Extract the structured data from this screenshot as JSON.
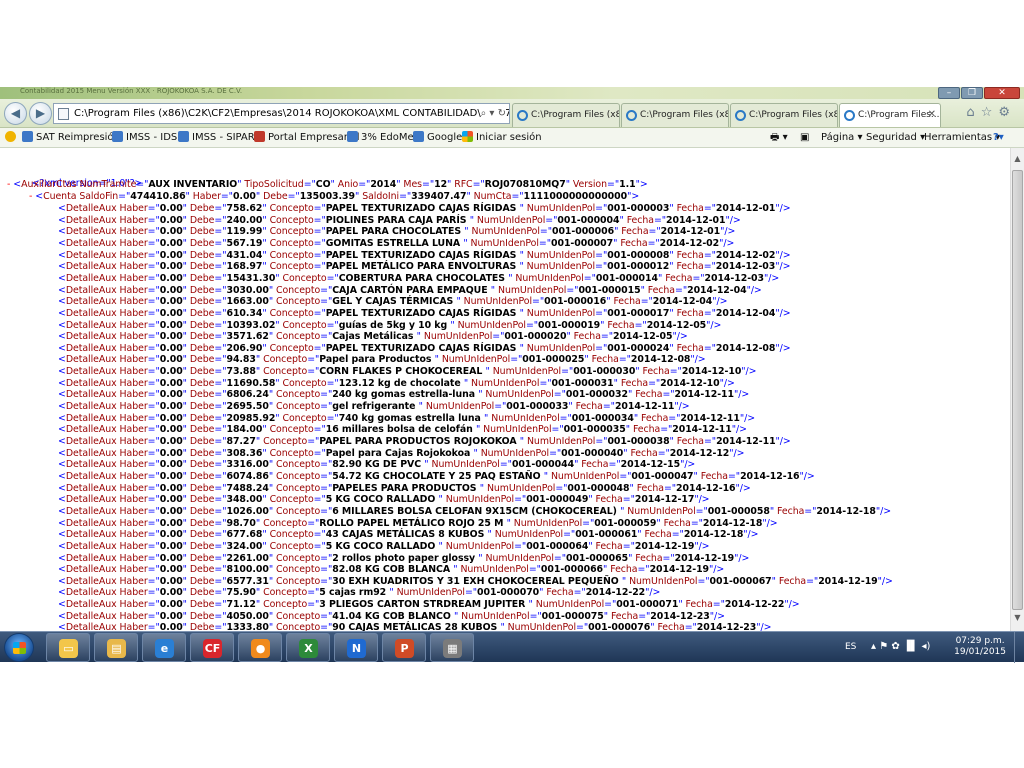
{
  "window": {
    "title_faded": "Contabilidad 2015 Menu Versión XXX · ROJOKOKOA S.A. DE C.V.",
    "buttons": [
      "–",
      "❐",
      "✕"
    ]
  },
  "toolbar": {
    "back_icon": "back-arrow-icon",
    "forward_icon": "forward-arrow-icon",
    "address": "C:\\Program Files (x86)\\C2K\\CF2\\Empresas\\2014 ROJOKOKOA\\XML CONTABILIDAD\\ROJ070810MQ7",
    "address_tools": "⌕ ▾ ↻"
  },
  "tabs": [
    {
      "label": "C:\\Program Files (x8..."
    },
    {
      "label": "C:\\Program Files (x8..."
    },
    {
      "label": "C:\\Program Files (x8..."
    },
    {
      "label": "C:\\Program Files...",
      "active": true
    }
  ],
  "favorites": [
    {
      "label": "SAT Reimpresión",
      "color": "#3d78c7"
    },
    {
      "label": "IMSS - IDSE",
      "color": "#3d78c7"
    },
    {
      "label": "IMSS - SIPARE",
      "color": "#3d78c7"
    },
    {
      "label": "Portal Empresarial",
      "color": "#c0392b"
    },
    {
      "label": "3% EdoMex",
      "color": "#3d78c7"
    },
    {
      "label": "Google",
      "color": "#3d78c7"
    },
    {
      "label": "Iniciar sesión",
      "color": "#e67e22"
    }
  ],
  "commands": {
    "page": "Página ▾",
    "safety": "Seguridad ▾",
    "tools": "Herramientas ▾",
    "help": "?▾"
  },
  "xml": {
    "declaration": "<?xml version=\"1.0\"?>",
    "root": {
      "NumTramite": "AUX INVENTARIO",
      "TipoSolicitud": "CO",
      "Anio": "2014",
      "Mes": "12",
      "RFC": "ROJ070810MQ7",
      "Version": "1.1"
    },
    "cuenta": {
      "SaldoFin": "474410.86",
      "Haber": "0.00",
      "Debe": "135003.39",
      "SaldoIni": "339407.47",
      "NumCta": "1111000000000000"
    },
    "rows": [
      {
        "Haber": "0.00",
        "Debe": "758.62",
        "Concepto": "PAPEL TEXTURIZADO CAJAS RÍGIDAS ",
        "NumUnIdenPol": "001-000003",
        "Fecha": "2014-12-01"
      },
      {
        "Haber": "0.00",
        "Debe": "240.00",
        "Concepto": "PIOLINES PARA CAJA PARÍS ",
        "NumUnIdenPol": "001-000004",
        "Fecha": "2014-12-01"
      },
      {
        "Haber": "0.00",
        "Debe": "119.99",
        "Concepto": "PAPEL PARA CHOCOLATES ",
        "NumUnIdenPol": "001-000006",
        "Fecha": "2014-12-01"
      },
      {
        "Haber": "0.00",
        "Debe": "567.19",
        "Concepto": "GOMITAS ESTRELLA LUNA ",
        "NumUnIdenPol": "001-000007",
        "Fecha": "2014-12-02"
      },
      {
        "Haber": "0.00",
        "Debe": "431.04",
        "Concepto": "PAPEL TEXTURIZADO CAJAS RÍGIDAS ",
        "NumUnIdenPol": "001-000008",
        "Fecha": "2014-12-02"
      },
      {
        "Haber": "0.00",
        "Debe": "168.97",
        "Concepto": "PAPEL METÁLICO PARA ENVOLTURAS ",
        "NumUnIdenPol": "001-000012",
        "Fecha": "2014-12-03"
      },
      {
        "Haber": "0.00",
        "Debe": "15431.30",
        "Concepto": "COBERTURA PARA CHOCOLATES ",
        "NumUnIdenPol": "001-000014",
        "Fecha": "2014-12-03"
      },
      {
        "Haber": "0.00",
        "Debe": "3030.00",
        "Concepto": "CAJA CARTÓN PARA EMPAQUE ",
        "NumUnIdenPol": "001-000015",
        "Fecha": "2014-12-04"
      },
      {
        "Haber": "0.00",
        "Debe": "1663.00",
        "Concepto": "GEL Y CAJAS TÉRMICAS ",
        "NumUnIdenPol": "001-000016",
        "Fecha": "2014-12-04"
      },
      {
        "Haber": "0.00",
        "Debe": "610.34",
        "Concepto": "PAPEL TEXTURIZADO CAJAS RÍGIDAS ",
        "NumUnIdenPol": "001-000017",
        "Fecha": "2014-12-04"
      },
      {
        "Haber": "0.00",
        "Debe": "10393.02",
        "Concepto": "guías de 5kg y 10 kg ",
        "NumUnIdenPol": "001-000019",
        "Fecha": "2014-12-05"
      },
      {
        "Haber": "0.00",
        "Debe": "3571.62",
        "Concepto": "Cajas Metálicas ",
        "NumUnIdenPol": "001-000020",
        "Fecha": "2014-12-05"
      },
      {
        "Haber": "0.00",
        "Debe": "206.90",
        "Concepto": "PAPEL TEXTURIZADO CAJAS RÍGIDAS ",
        "NumUnIdenPol": "001-000024",
        "Fecha": "2014-12-08"
      },
      {
        "Haber": "0.00",
        "Debe": "94.83",
        "Concepto": "Papel para Productos ",
        "NumUnIdenPol": "001-000025",
        "Fecha": "2014-12-08"
      },
      {
        "Haber": "0.00",
        "Debe": "73.88",
        "Concepto": "CORN FLAKES P CHOKOCEREAL ",
        "NumUnIdenPol": "001-000030",
        "Fecha": "2014-12-10"
      },
      {
        "Haber": "0.00",
        "Debe": "11690.58",
        "Concepto": "123.12 kg de chocolate ",
        "NumUnIdenPol": "001-000031",
        "Fecha": "2014-12-10"
      },
      {
        "Haber": "0.00",
        "Debe": "6806.24",
        "Concepto": "240 kg gomas estrella-luna ",
        "NumUnIdenPol": "001-000032",
        "Fecha": "2014-12-11"
      },
      {
        "Haber": "0.00",
        "Debe": "2695.50",
        "Concepto": "gel refrigerante ",
        "NumUnIdenPol": "001-000033",
        "Fecha": "2014-12-11"
      },
      {
        "Haber": "0.00",
        "Debe": "20985.92",
        "Concepto": "740 kg gomas estrella luna ",
        "NumUnIdenPol": "001-000034",
        "Fecha": "2014-12-11"
      },
      {
        "Haber": "0.00",
        "Debe": "184.00",
        "Concepto": "16 millares bolsa de celofán ",
        "NumUnIdenPol": "001-000035",
        "Fecha": "2014-12-11"
      },
      {
        "Haber": "0.00",
        "Debe": "87.27",
        "Concepto": "PAPEL PARA PRODUCTOS ROJOKOKOA ",
        "NumUnIdenPol": "001-000038",
        "Fecha": "2014-12-11"
      },
      {
        "Haber": "0.00",
        "Debe": "308.36",
        "Concepto": "Papel para Cajas Rojokokoa ",
        "NumUnIdenPol": "001-000040",
        "Fecha": "2014-12-12"
      },
      {
        "Haber": "0.00",
        "Debe": "3316.00",
        "Concepto": "82.90 KG DE PVC ",
        "NumUnIdenPol": "001-000044",
        "Fecha": "2014-12-15"
      },
      {
        "Haber": "0.00",
        "Debe": "6074.86",
        "Concepto": "54.72 KG CHOCOLATE Y 25 PAQ ESTAÑO ",
        "NumUnIdenPol": "001-000047",
        "Fecha": "2014-12-16"
      },
      {
        "Haber": "0.00",
        "Debe": "7488.24",
        "Concepto": "PAPELES PARA PRODUCTOS ",
        "NumUnIdenPol": "001-000048",
        "Fecha": "2014-12-16"
      },
      {
        "Haber": "0.00",
        "Debe": "348.00",
        "Concepto": "5 KG COCO RALLADO ",
        "NumUnIdenPol": "001-000049",
        "Fecha": "2014-12-17"
      },
      {
        "Haber": "0.00",
        "Debe": "1026.00",
        "Concepto": "6 MILLARES BOLSA CELOFAN 9X15CM (CHOKOCEREAL) ",
        "NumUnIdenPol": "001-000058",
        "Fecha": "2014-12-18"
      },
      {
        "Haber": "0.00",
        "Debe": "98.70",
        "Concepto": "ROLLO PAPEL METÁLICO ROJO 25 M ",
        "NumUnIdenPol": "001-000059",
        "Fecha": "2014-12-18"
      },
      {
        "Haber": "0.00",
        "Debe": "677.68",
        "Concepto": "43 CAJAS METÁLICAS 8 KUBOS ",
        "NumUnIdenPol": "001-000061",
        "Fecha": "2014-12-18"
      },
      {
        "Haber": "0.00",
        "Debe": "324.00",
        "Concepto": "5 KG COCO RALLADO ",
        "NumUnIdenPol": "001-000064",
        "Fecha": "2014-12-19"
      },
      {
        "Haber": "0.00",
        "Debe": "2261.00",
        "Concepto": "2 rollos photo paper glossy ",
        "NumUnIdenPol": "001-000065",
        "Fecha": "2014-12-19"
      },
      {
        "Haber": "0.00",
        "Debe": "8100.00",
        "Concepto": "82.08 KG COB BLANCA ",
        "NumUnIdenPol": "001-000066",
        "Fecha": "2014-12-19"
      },
      {
        "Haber": "0.00",
        "Debe": "6577.31",
        "Concepto": "30 EXH KUADRITOS Y 31 EXH CHOKOCEREAL PEQUEÑO ",
        "NumUnIdenPol": "001-000067",
        "Fecha": "2014-12-19"
      },
      {
        "Haber": "0.00",
        "Debe": "75.90",
        "Concepto": "5 cajas rm92 ",
        "NumUnIdenPol": "001-000070",
        "Fecha": "2014-12-22"
      },
      {
        "Haber": "0.00",
        "Debe": "71.12",
        "Concepto": "3 PLIEGOS CARTON STRDREAM JUPITER ",
        "NumUnIdenPol": "001-000071",
        "Fecha": "2014-12-22"
      },
      {
        "Haber": "0.00",
        "Debe": "4050.00",
        "Concepto": "41.04 KG COB BLANCO ",
        "NumUnIdenPol": "001-000075",
        "Fecha": "2014-12-23"
      },
      {
        "Haber": "0.00",
        "Debe": "1333.80",
        "Concepto": "90 CAJAS METÁLICAS 28 KUBOS ",
        "NumUnIdenPol": "001-000076",
        "Fecha": "2014-12-23"
      }
    ]
  },
  "taskbar": {
    "apps": [
      {
        "name": "show-windows",
        "glyph": "▭",
        "color": "#f3c64a"
      },
      {
        "name": "file-explorer",
        "glyph": "▤",
        "color": "#e8b84a"
      },
      {
        "name": "internet-explorer",
        "glyph": "e",
        "color": "#2a7fd4"
      },
      {
        "name": "cf-app",
        "glyph": "CF",
        "color": "#d9262c"
      },
      {
        "name": "orange-app",
        "glyph": "●",
        "color": "#f08a1c"
      },
      {
        "name": "excel",
        "glyph": "X",
        "color": "#2d8a3a"
      },
      {
        "name": "n-app",
        "glyph": "N",
        "color": "#1f6ad1"
      },
      {
        "name": "powerpoint",
        "glyph": "P",
        "color": "#d04b26"
      },
      {
        "name": "document-app",
        "glyph": "▦",
        "color": "#7b7b7b"
      }
    ],
    "language": "ES",
    "time": "07:29 p.m.",
    "date": "19/01/2015"
  }
}
